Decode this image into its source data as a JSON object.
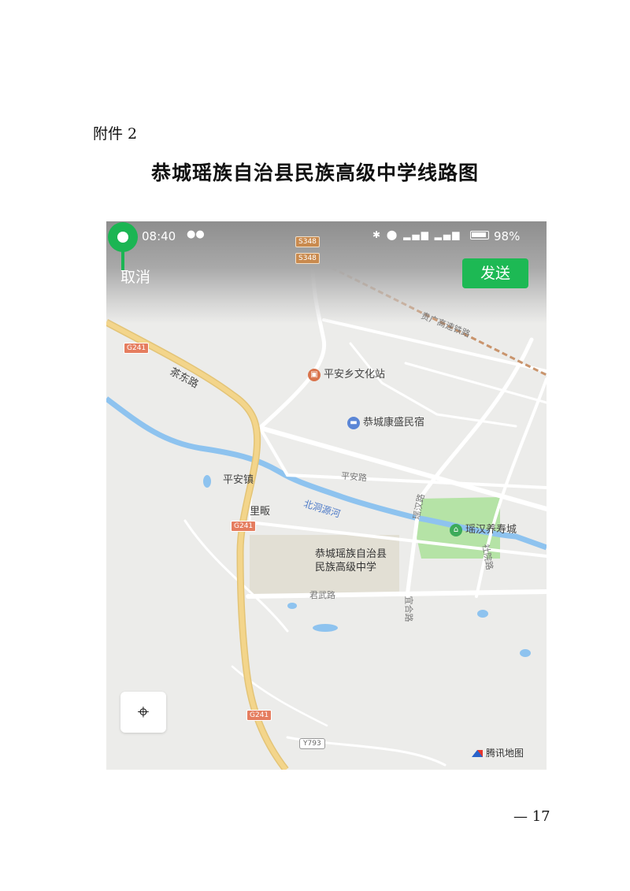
{
  "document": {
    "attachment_label": "附件 2",
    "title": "恭城瑶族自治县民族高级中学线路图",
    "page_number": "— 17"
  },
  "status_bar": {
    "time": "08:40",
    "battery": "98%"
  },
  "header": {
    "cancel_label": "取消",
    "send_label": "发送"
  },
  "map": {
    "road_badges": {
      "s348_top": "S348",
      "s348_bottom": "S348",
      "g241_top": "G241",
      "g241_mid": "G241",
      "g241_bottom": "G241",
      "y793": "Y793"
    },
    "labels": {
      "railway": "贵广高速铁路",
      "chadong_road": "茶东路",
      "ping_an_town": "平安镇",
      "li_an": "里畈",
      "beidong_river": "北洞源河",
      "ping_an_road": "平安路",
      "yaohan_road": "瑶汉路",
      "shejiao_road": "社院路",
      "junwu_road": "君武路",
      "side_road": "宜合路"
    },
    "pois": {
      "culture_station": "平安乡文化站",
      "homestay": "恭城康盛民宿",
      "yaohan_elderly_city": "瑶汉养寿城"
    },
    "selected_place": {
      "line1": "恭城瑶族自治县",
      "line2": "民族高级中学"
    },
    "provider": "腾讯地图",
    "colors": {
      "pin": "#1bb553",
      "send_button": "#1db954",
      "park": "#b5e3a6",
      "water": "#8ec3ef",
      "highway": "#f3d58b"
    }
  }
}
